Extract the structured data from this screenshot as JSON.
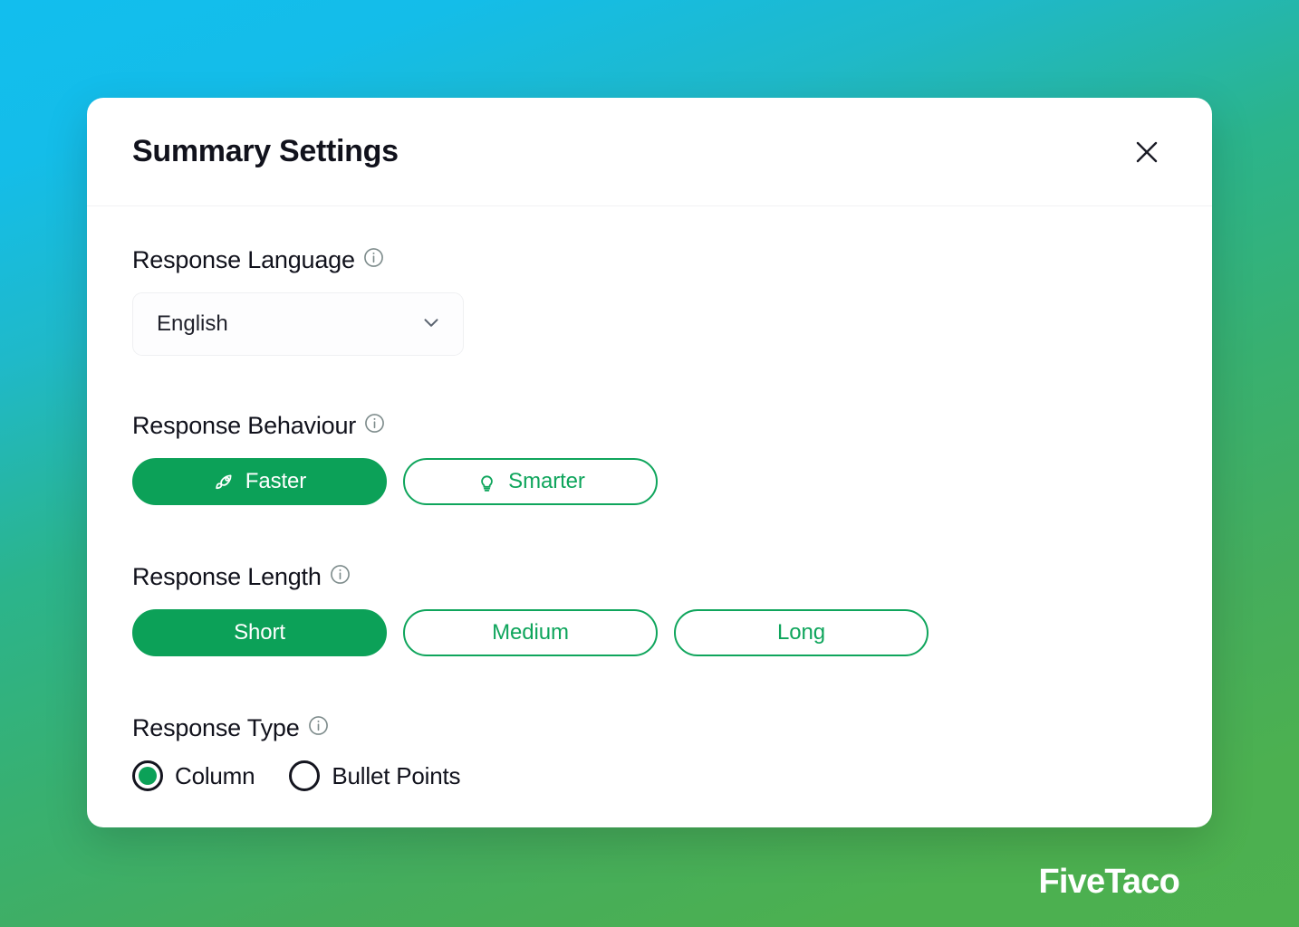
{
  "brand": {
    "name": "FiveTaco"
  },
  "modal": {
    "title": "Summary Settings",
    "close_icon": "close-icon",
    "sections": {
      "language": {
        "label": "Response Language",
        "info_icon": "info-icon",
        "selected": "English",
        "chevron_icon": "chevron-down-icon"
      },
      "behaviour": {
        "label": "Response Behaviour",
        "info_icon": "info-icon",
        "options": [
          {
            "label": "Faster",
            "icon": "rocket-icon",
            "active": true
          },
          {
            "label": "Smarter",
            "icon": "lightbulb-icon",
            "active": false
          }
        ]
      },
      "length": {
        "label": "Response Length",
        "info_icon": "info-icon",
        "options": [
          {
            "label": "Short",
            "active": true
          },
          {
            "label": "Medium",
            "active": false
          },
          {
            "label": "Long",
            "active": false
          }
        ]
      },
      "type": {
        "label": "Response Type",
        "info_icon": "info-icon",
        "options": [
          {
            "label": "Column",
            "selected": true
          },
          {
            "label": "Bullet Points",
            "selected": false
          }
        ]
      }
    }
  },
  "colors": {
    "accent_green": "#0CA158",
    "accent_green_border": "#0FA55C",
    "title_dark": "#11121C",
    "info_gray": "#7E8C8C",
    "bg_cyan": "#12BEEE",
    "bg_green": "#4CB050"
  }
}
